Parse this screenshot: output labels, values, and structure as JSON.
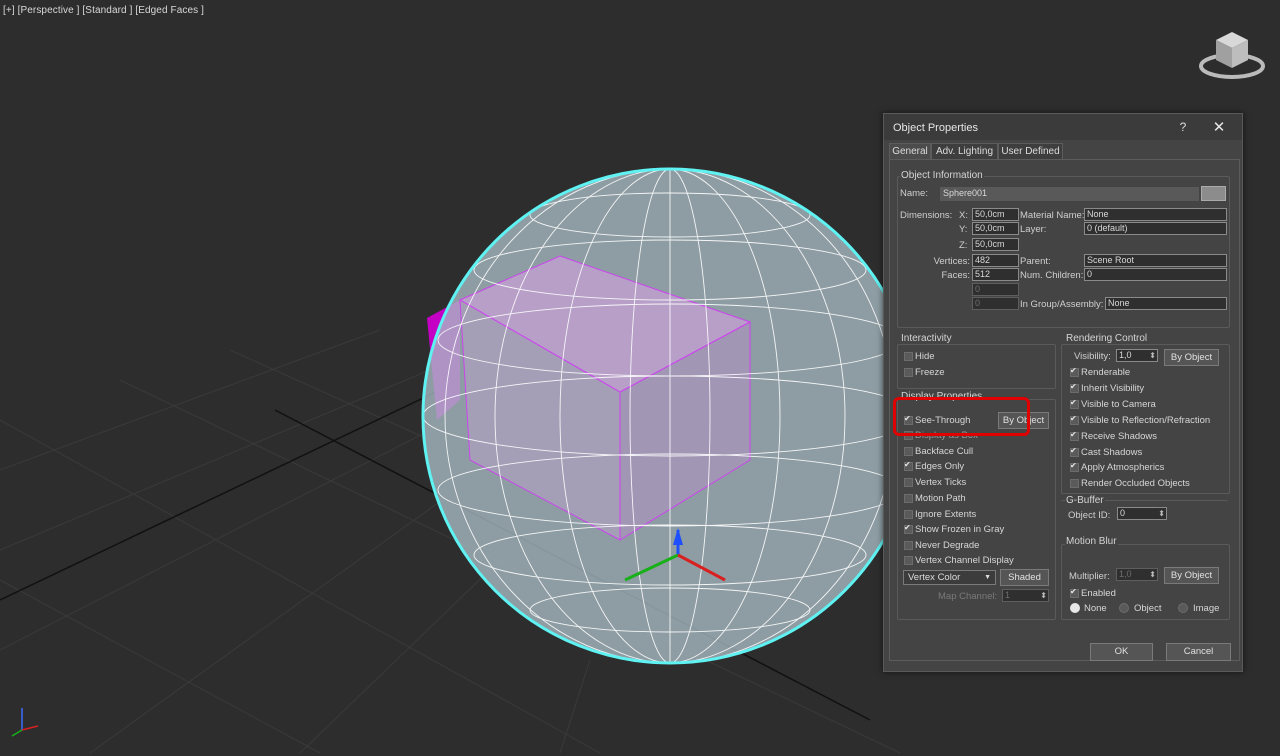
{
  "viewport": {
    "label": "[+] [Perspective ] [Standard ] [Edged Faces ]"
  },
  "dialog": {
    "title": "Object Properties",
    "help": "?",
    "close": "✕",
    "tabs": [
      "General",
      "Adv. Lighting",
      "User Defined"
    ],
    "object_info": {
      "title": "Object Information",
      "name_label": "Name:",
      "name": "Sphere001",
      "dimensions_label": "Dimensions:",
      "x_label": "X:",
      "x": "50,0cm",
      "y_label": "Y:",
      "y": "50,0cm",
      "z_label": "Z:",
      "z": "50,0cm",
      "vertices_label": "Vertices:",
      "vertices": "482",
      "faces_label": "Faces:",
      "faces": "512",
      "blank1": "0",
      "blank2": "0",
      "material_label": "Material Name:",
      "material": "None",
      "layer_label": "Layer:",
      "layer": "0 (default)",
      "parent_label": "Parent:",
      "parent": "Scene Root",
      "children_label": "Num. Children:",
      "children": "0",
      "group_label": "In Group/Assembly:",
      "group": "None"
    },
    "interactivity": {
      "title": "Interactivity",
      "hide": "Hide",
      "freeze": "Freeze"
    },
    "display": {
      "title": "Display Properties",
      "see_through": "See-Through",
      "display_as_box": "Display as Box",
      "by_object": "By Object",
      "backface": "Backface Cull",
      "edges_only": "Edges Only",
      "vertex_ticks": "Vertex Ticks",
      "motion_path": "Motion Path",
      "ignore_extents": "Ignore Extents",
      "show_frozen": "Show Frozen in Gray",
      "never_degrade": "Never Degrade",
      "vertex_channel": "Vertex Channel Display",
      "vertex_color": "Vertex Color",
      "shaded": "Shaded",
      "map_channel_label": "Map Channel:",
      "map_channel": "1"
    },
    "rendering": {
      "title": "Rendering Control",
      "visibility_label": "Visibility:",
      "visibility": "1,0",
      "by_object": "By Object",
      "renderable": "Renderable",
      "inherit": "Inherit Visibility",
      "visible_camera": "Visible to Camera",
      "visible_reflection": "Visible to Reflection/Refraction",
      "receive_shadows": "Receive Shadows",
      "cast_shadows": "Cast Shadows",
      "apply_atmos": "Apply Atmospherics",
      "render_occluded": "Render Occluded Objects"
    },
    "gbuffer": {
      "title": "G-Buffer",
      "object_id_label": "Object ID:",
      "object_id": "0"
    },
    "motion_blur": {
      "title": "Motion Blur",
      "multiplier_label": "Multiplier:",
      "multiplier": "1,0",
      "by_object": "By Object",
      "enabled": "Enabled",
      "none": "None",
      "object": "Object",
      "image": "Image"
    },
    "ok": "OK",
    "cancel": "Cancel"
  }
}
